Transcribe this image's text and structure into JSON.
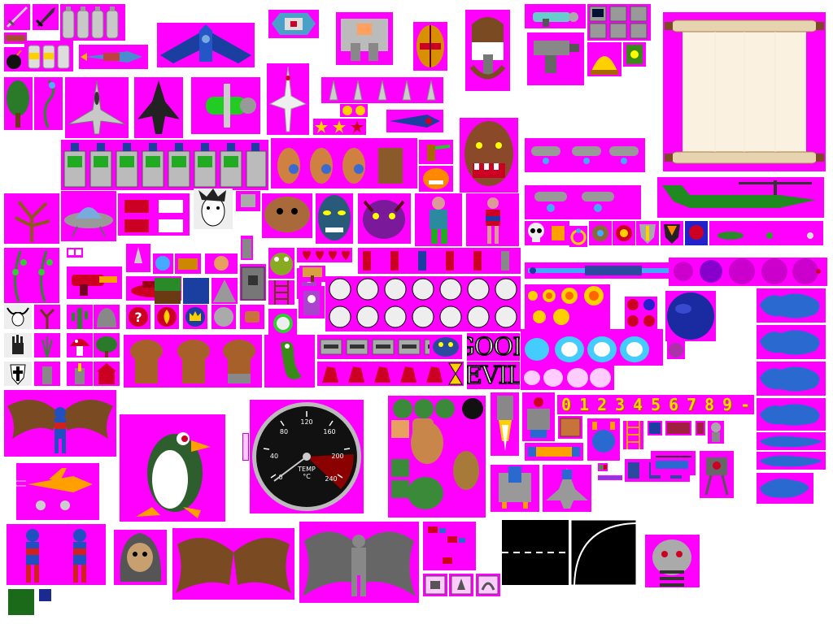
{
  "sheet": {
    "background": "#ffffff",
    "transparency_key": "#ff00ff"
  },
  "labels": {
    "good": "GOOD",
    "evil": "EVIL",
    "digits": [
      "0",
      "1",
      "2",
      "3",
      "4",
      "5",
      "6",
      "7",
      "8",
      "9",
      "-"
    ]
  },
  "gauge": {
    "ticks": [
      "0",
      "40",
      "80",
      "120",
      "160",
      "200",
      "240"
    ],
    "unit_line1": "TEMP",
    "unit_line2": "°C",
    "danger_color": "#8b0000"
  },
  "palette": {
    "magenta": "#ff00ff",
    "wing_brown": "#7a4a22",
    "hero_blue": "#2050c0",
    "hero_red": "#d02020",
    "penguin_green": "#2e5e2e",
    "parchment": "#fbf1e0",
    "heli_green": "#1f8a1f",
    "flame_yellow": "#ffd000"
  },
  "sprites": [
    "sword-icon",
    "dagger-icon",
    "gas-tank-icon",
    "spaceship-icon",
    "robot-head-icon",
    "mech-body-icon",
    "lifepod-icon",
    "biplane-icon",
    "laser-gun-icon",
    "parchment-scroll-icon",
    "tree-icon",
    "vine-icon",
    "fighter-jet-icon",
    "ufo-icon",
    "demon-face-icon",
    "rat-creature-icon",
    "alien-face-icon",
    "warrior-woman-icon",
    "barbarian-icon",
    "skull-icon",
    "amulet-icon",
    "helicopter-icon",
    "smiley-face-icon",
    "muscleman-icon",
    "seahorse-icon",
    "pistol-icon",
    "missile-icon",
    "bat-winged-hero-icon",
    "penguin-icon",
    "temperature-gauge-icon",
    "green-head-icon",
    "black-bomb-icon",
    "rocket-engine-icon",
    "spaceship-rear-icon",
    "walker-robot-icon",
    "road-straight-icon",
    "road-curve-icon",
    "ogre-head-icon",
    "hooded-skull-icon",
    "bat-wings-icon",
    "bat-man-creature-icon",
    "explosion-icon",
    "cloud-icon",
    "planet-icon",
    "blue-blob-icon"
  ]
}
